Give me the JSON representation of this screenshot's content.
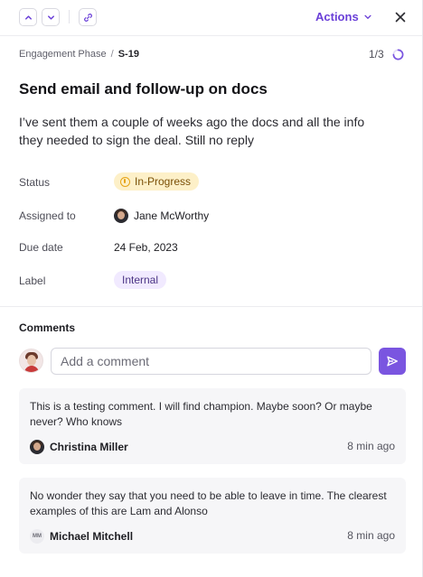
{
  "toolbar": {
    "actions_label": "Actions"
  },
  "breadcrumb": {
    "phase": "Engagement Phase",
    "separator": "/",
    "task_id": "S-19"
  },
  "pager": {
    "position": "1/3"
  },
  "task": {
    "title": "Send email and follow-up on docs",
    "description": "I’ve sent them a couple of weeks ago the docs and all the info they needed to sign the deal. Still no reply"
  },
  "fields": {
    "status_label": "Status",
    "status_value": "In-Progress",
    "assigned_label": "Assigned to",
    "assigned_value": "Jane McWorthy",
    "due_label": "Due date",
    "due_value": "24 Feb, 2023",
    "label_label": "Label",
    "label_value": "Internal"
  },
  "comments": {
    "heading": "Comments",
    "input_placeholder": "Add a comment",
    "items": [
      {
        "text": "This is a testing comment. I will find champion. Maybe soon? Or maybe never? Who knows",
        "author": "Christina Miller",
        "time": "8 min ago"
      },
      {
        "text": "No wonder they say that you need to be able to leave in time. The clearest examples of this are Lam and Alonso",
        "author": "Michael Mitchell",
        "initials": "MM",
        "time": "8 min ago"
      }
    ]
  },
  "colors": {
    "accent": "#7a55e0",
    "status_bg": "#fdf0c8",
    "label_bg": "#f1eaff"
  }
}
